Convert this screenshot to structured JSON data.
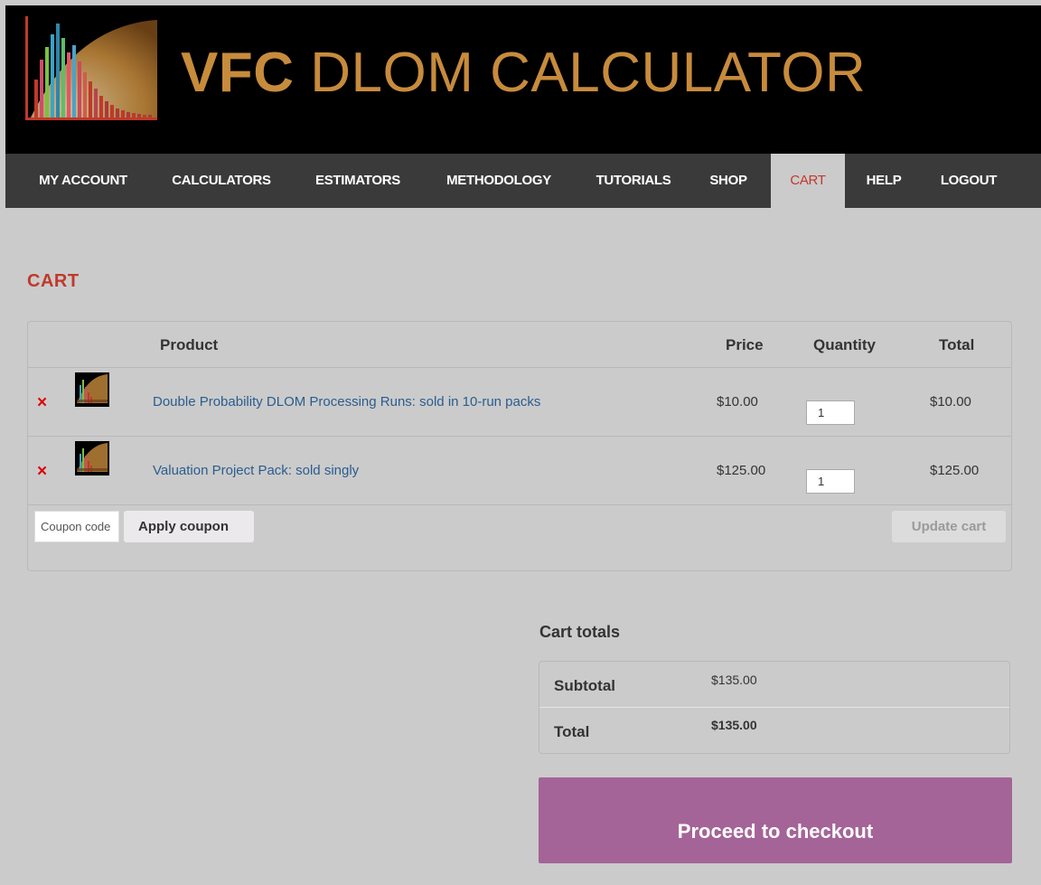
{
  "header": {
    "title_bold": "VFC",
    "title_rest": "DLOM CALCULATOR"
  },
  "nav": {
    "items": [
      {
        "label": "MY ACCOUNT"
      },
      {
        "label": "CALCULATORS"
      },
      {
        "label": "ESTIMATORS"
      },
      {
        "label": "METHODOLOGY"
      },
      {
        "label": "TUTORIALS"
      },
      {
        "label": "SHOP"
      },
      {
        "label": "CART",
        "active": true
      },
      {
        "label": "HELP"
      },
      {
        "label": "LOGOUT"
      }
    ]
  },
  "cart": {
    "heading": "CART",
    "columns": {
      "product": "Product",
      "price": "Price",
      "quantity": "Quantity",
      "total": "Total"
    },
    "remove_glyph": "×",
    "rows": [
      {
        "name": "Double Probability DLOM Processing Runs: sold in 10-run packs",
        "price": "$10.00",
        "quantity": "1",
        "total": "$10.00"
      },
      {
        "name": "Valuation Project Pack: sold singly",
        "price": "$125.00",
        "quantity": "1",
        "total": "$125.00"
      }
    ],
    "coupon_placeholder": "Coupon code",
    "apply_coupon_label": "Apply coupon",
    "update_cart_label": "Update cart"
  },
  "totals": {
    "heading": "Cart totals",
    "subtotal_label": "Subtotal",
    "subtotal_value": "$135.00",
    "total_label": "Total",
    "total_value": "$135.00"
  },
  "checkout_label": "Proceed to checkout",
  "colors": {
    "brand_gold": "#c78b3c",
    "nav_bg": "#3a3a3a",
    "accent_red": "#c0392b",
    "checkout_purple": "#a46497"
  }
}
